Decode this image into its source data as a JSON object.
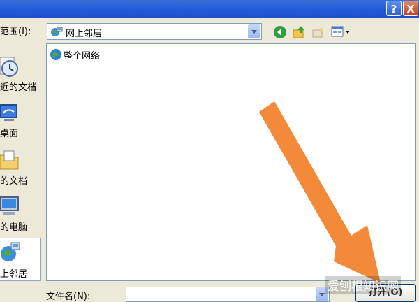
{
  "dialog": {
    "help_label": "?",
    "close_label": "X"
  },
  "lookin": {
    "label": "范围(I):",
    "value": "网上邻居"
  },
  "places": [
    {
      "label": "近的文档",
      "icon": "recent-documents-icon"
    },
    {
      "label": "桌面",
      "icon": "desktop-icon"
    },
    {
      "label": "的文档",
      "icon": "my-documents-icon"
    },
    {
      "label": "的电脑",
      "icon": "my-computer-icon"
    },
    {
      "label": "上邻居",
      "icon": "network-places-icon"
    }
  ],
  "files": [
    {
      "name": "整个网络",
      "icon": "entire-network-icon"
    }
  ],
  "bottom": {
    "filename_label": "文件名(N):",
    "filename_value": "",
    "open_label": "打开(O)"
  },
  "watermark": "爱刨根知识网",
  "colors": {
    "titlebar": "#245edb",
    "dialog_bg": "#ece9d8",
    "border": "#7f9db9",
    "arrow": "#f28a3a"
  }
}
